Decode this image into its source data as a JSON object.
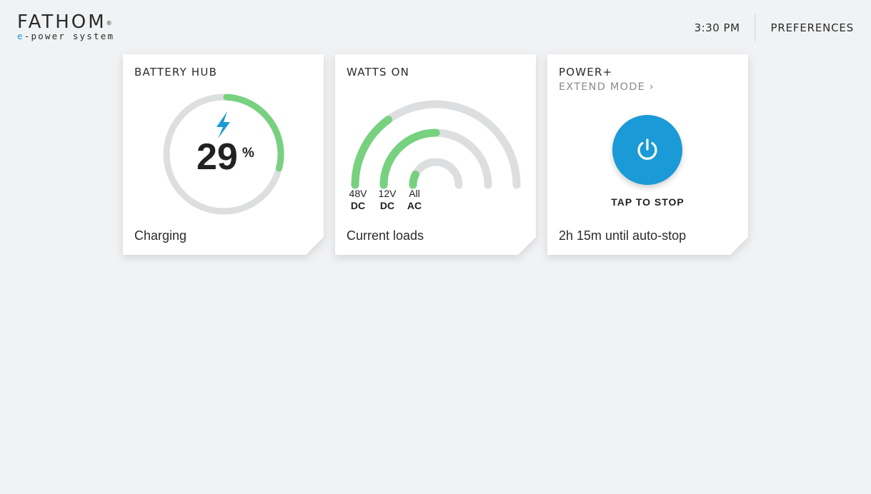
{
  "header": {
    "brand_name": "FATHOM",
    "brand_mark": "®",
    "brand_sub_prefix": "e",
    "brand_sub_rest": "-power system",
    "time": "3:30 PM",
    "preferences_label": "PREFERENCES"
  },
  "battery": {
    "title": "BATTERY HUB",
    "percent": 29,
    "percent_text": "29",
    "percent_sign": "%",
    "status": "Charging",
    "accent": "#77d17f",
    "track": "#dcdee0",
    "icon": "lightning-bolt-icon",
    "icon_color": "#1a9ad6"
  },
  "watts": {
    "title": "WATTS ON",
    "footer": "Current loads",
    "loads": [
      {
        "top": "48V",
        "bottom": "DC",
        "fraction": 0.3
      },
      {
        "top": "12V",
        "bottom": "DC",
        "fraction": 0.5
      },
      {
        "top": "All",
        "bottom": "AC",
        "fraction": 0.15
      }
    ]
  },
  "power": {
    "title": "POWER+",
    "mode_label": "EXTEND MODE",
    "chevron": "›",
    "button_icon": "power-icon",
    "button_color": "#1a9ad6",
    "action_label": "TAP TO STOP",
    "footer": "2h 15m until auto-stop"
  }
}
